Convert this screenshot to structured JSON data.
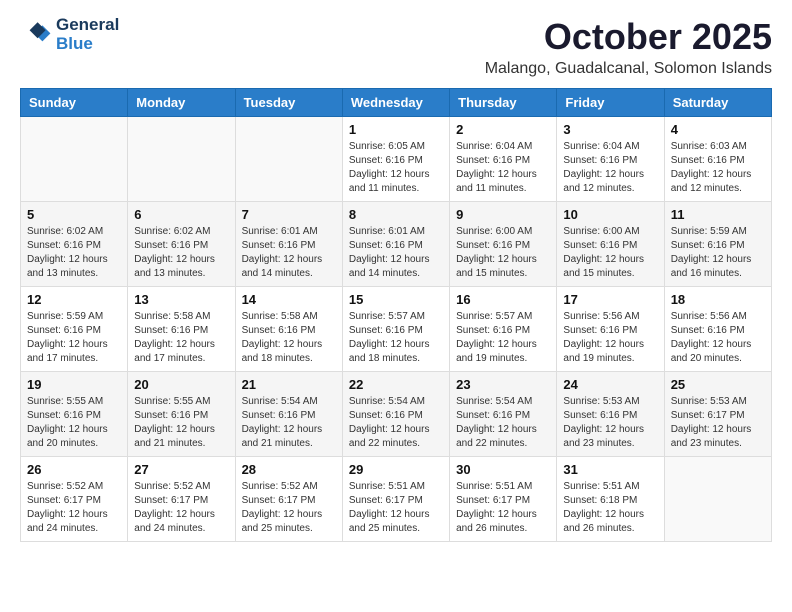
{
  "header": {
    "logo_line1": "General",
    "logo_line2": "Blue",
    "month_title": "October 2025",
    "location": "Malango, Guadalcanal, Solomon Islands"
  },
  "weekdays": [
    "Sunday",
    "Monday",
    "Tuesday",
    "Wednesday",
    "Thursday",
    "Friday",
    "Saturday"
  ],
  "weeks": [
    [
      {
        "day": "",
        "info": ""
      },
      {
        "day": "",
        "info": ""
      },
      {
        "day": "",
        "info": ""
      },
      {
        "day": "1",
        "info": "Sunrise: 6:05 AM\nSunset: 6:16 PM\nDaylight: 12 hours and 11 minutes."
      },
      {
        "day": "2",
        "info": "Sunrise: 6:04 AM\nSunset: 6:16 PM\nDaylight: 12 hours and 11 minutes."
      },
      {
        "day": "3",
        "info": "Sunrise: 6:04 AM\nSunset: 6:16 PM\nDaylight: 12 hours and 12 minutes."
      },
      {
        "day": "4",
        "info": "Sunrise: 6:03 AM\nSunset: 6:16 PM\nDaylight: 12 hours and 12 minutes."
      }
    ],
    [
      {
        "day": "5",
        "info": "Sunrise: 6:02 AM\nSunset: 6:16 PM\nDaylight: 12 hours and 13 minutes."
      },
      {
        "day": "6",
        "info": "Sunrise: 6:02 AM\nSunset: 6:16 PM\nDaylight: 12 hours and 13 minutes."
      },
      {
        "day": "7",
        "info": "Sunrise: 6:01 AM\nSunset: 6:16 PM\nDaylight: 12 hours and 14 minutes."
      },
      {
        "day": "8",
        "info": "Sunrise: 6:01 AM\nSunset: 6:16 PM\nDaylight: 12 hours and 14 minutes."
      },
      {
        "day": "9",
        "info": "Sunrise: 6:00 AM\nSunset: 6:16 PM\nDaylight: 12 hours and 15 minutes."
      },
      {
        "day": "10",
        "info": "Sunrise: 6:00 AM\nSunset: 6:16 PM\nDaylight: 12 hours and 15 minutes."
      },
      {
        "day": "11",
        "info": "Sunrise: 5:59 AM\nSunset: 6:16 PM\nDaylight: 12 hours and 16 minutes."
      }
    ],
    [
      {
        "day": "12",
        "info": "Sunrise: 5:59 AM\nSunset: 6:16 PM\nDaylight: 12 hours and 17 minutes."
      },
      {
        "day": "13",
        "info": "Sunrise: 5:58 AM\nSunset: 6:16 PM\nDaylight: 12 hours and 17 minutes."
      },
      {
        "day": "14",
        "info": "Sunrise: 5:58 AM\nSunset: 6:16 PM\nDaylight: 12 hours and 18 minutes."
      },
      {
        "day": "15",
        "info": "Sunrise: 5:57 AM\nSunset: 6:16 PM\nDaylight: 12 hours and 18 minutes."
      },
      {
        "day": "16",
        "info": "Sunrise: 5:57 AM\nSunset: 6:16 PM\nDaylight: 12 hours and 19 minutes."
      },
      {
        "day": "17",
        "info": "Sunrise: 5:56 AM\nSunset: 6:16 PM\nDaylight: 12 hours and 19 minutes."
      },
      {
        "day": "18",
        "info": "Sunrise: 5:56 AM\nSunset: 6:16 PM\nDaylight: 12 hours and 20 minutes."
      }
    ],
    [
      {
        "day": "19",
        "info": "Sunrise: 5:55 AM\nSunset: 6:16 PM\nDaylight: 12 hours and 20 minutes."
      },
      {
        "day": "20",
        "info": "Sunrise: 5:55 AM\nSunset: 6:16 PM\nDaylight: 12 hours and 21 minutes."
      },
      {
        "day": "21",
        "info": "Sunrise: 5:54 AM\nSunset: 6:16 PM\nDaylight: 12 hours and 21 minutes."
      },
      {
        "day": "22",
        "info": "Sunrise: 5:54 AM\nSunset: 6:16 PM\nDaylight: 12 hours and 22 minutes."
      },
      {
        "day": "23",
        "info": "Sunrise: 5:54 AM\nSunset: 6:16 PM\nDaylight: 12 hours and 22 minutes."
      },
      {
        "day": "24",
        "info": "Sunrise: 5:53 AM\nSunset: 6:16 PM\nDaylight: 12 hours and 23 minutes."
      },
      {
        "day": "25",
        "info": "Sunrise: 5:53 AM\nSunset: 6:17 PM\nDaylight: 12 hours and 23 minutes."
      }
    ],
    [
      {
        "day": "26",
        "info": "Sunrise: 5:52 AM\nSunset: 6:17 PM\nDaylight: 12 hours and 24 minutes."
      },
      {
        "day": "27",
        "info": "Sunrise: 5:52 AM\nSunset: 6:17 PM\nDaylight: 12 hours and 24 minutes."
      },
      {
        "day": "28",
        "info": "Sunrise: 5:52 AM\nSunset: 6:17 PM\nDaylight: 12 hours and 25 minutes."
      },
      {
        "day": "29",
        "info": "Sunrise: 5:51 AM\nSunset: 6:17 PM\nDaylight: 12 hours and 25 minutes."
      },
      {
        "day": "30",
        "info": "Sunrise: 5:51 AM\nSunset: 6:17 PM\nDaylight: 12 hours and 26 minutes."
      },
      {
        "day": "31",
        "info": "Sunrise: 5:51 AM\nSunset: 6:18 PM\nDaylight: 12 hours and 26 minutes."
      },
      {
        "day": "",
        "info": ""
      }
    ]
  ]
}
